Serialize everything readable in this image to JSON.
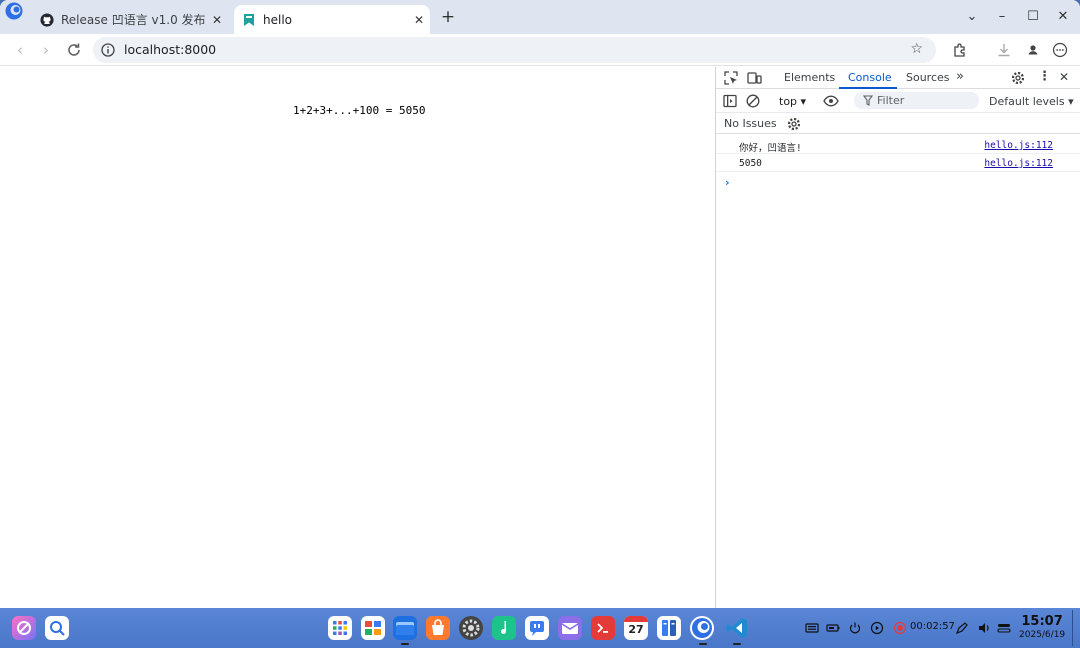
{
  "browser": {
    "tabs": [
      {
        "title": "Release 凹语言 v1.0 发布",
        "active": false,
        "favicon": "github-icon"
      },
      {
        "title": "hello",
        "active": true,
        "favicon": "bookmark-favicon"
      }
    ],
    "address": "localhost:8000"
  },
  "page": {
    "output_text": "1+2+3+...+100 = 5050"
  },
  "devtools": {
    "tabs": [
      "Elements",
      "Console",
      "Sources"
    ],
    "active_tab": "Console",
    "context": "top",
    "filter_placeholder": "Filter",
    "levels": "Default levels",
    "issues": "No Issues",
    "logs": [
      {
        "message": "你好，凹语言!",
        "source": "hello.js:112"
      },
      {
        "message": "5050",
        "source": "hello.js:112"
      }
    ],
    "prompt": "›",
    "accent_color": "#0b57d0"
  },
  "taskbar": {
    "calendar_day": "27",
    "recording_time": "00:02:57",
    "time": "15:07",
    "date": "2025/6/19"
  }
}
